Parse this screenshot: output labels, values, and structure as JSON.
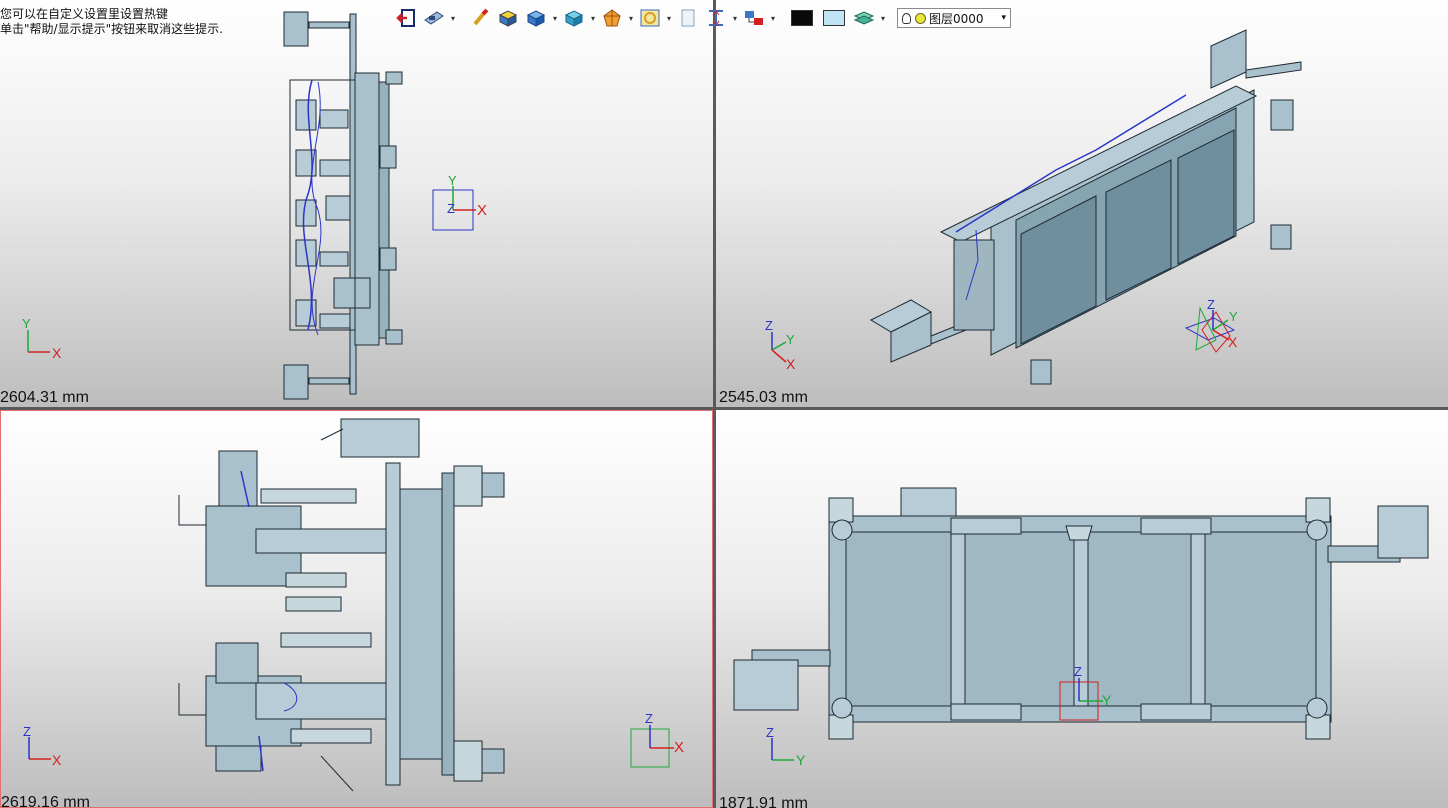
{
  "hint": {
    "line1": "您可以在自定义设置里设置热键",
    "line2": "单击\"帮助/显示提示\"按钮来取消这些提示."
  },
  "viewports": {
    "top_left": {
      "scale": "2604.31 mm",
      "view": "front"
    },
    "top_right": {
      "scale": "2545.03 mm",
      "view": "isometric"
    },
    "bottom_left": {
      "scale": "2619.16 mm",
      "view": "side"
    },
    "bottom_right": {
      "scale": "1871.91 mm",
      "view": "top"
    }
  },
  "axes": {
    "x": "X",
    "y": "Y",
    "z": "Z"
  },
  "toolbar": {
    "buttons": [
      "exit-icon",
      "view-display-icon",
      "pencil-icon",
      "solid-box-icon",
      "shaded-cube-icon",
      "render-mode-icon",
      "section-icon",
      "wrap-icon",
      "page-icon",
      "measure-icon",
      "model-tree-icon"
    ],
    "color_swatch_1": "#0a0a0a",
    "color_swatch_2": "#bfe4f4",
    "layer_label": "图层0000"
  },
  "colors": {
    "part_fill": "#a9c1cc",
    "part_stroke": "#1d2a33",
    "wire": "#2a35c8",
    "axis_x": "#d42020",
    "axis_y": "#1fa83a",
    "axis_z": "#2a35c8"
  }
}
